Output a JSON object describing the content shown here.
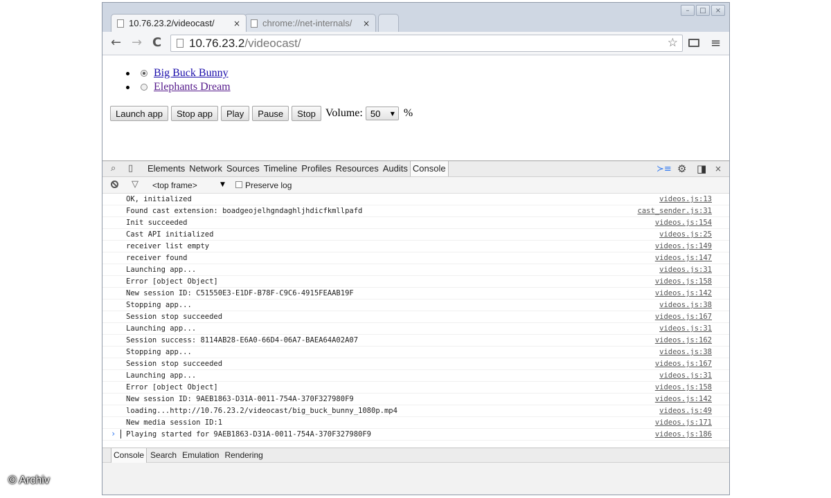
{
  "browser": {
    "tabs": [
      {
        "title": "10.76.23.2/videocast/",
        "active": true
      },
      {
        "title": "chrome://net-internals/",
        "active": false
      }
    ],
    "tab_close": "×",
    "window_buttons": {
      "minimize": "–",
      "maximize": "□",
      "close": "×"
    },
    "nav": {
      "back": "←",
      "forward": "→",
      "reload": "C"
    },
    "url": {
      "host": "10.76.23.2",
      "path": "/videocast/"
    },
    "star": "☆",
    "menu": "≡"
  },
  "page": {
    "videos": [
      {
        "title": "Big Buck Bunny",
        "selected": true
      },
      {
        "title": "Elephants Dream",
        "selected": false
      }
    ],
    "buttons": {
      "launch": "Launch app",
      "stop_app": "Stop app",
      "play": "Play",
      "pause": "Pause",
      "stop": "Stop"
    },
    "volume_label": "Volume:",
    "volume_value": "50",
    "volume_unit": "%"
  },
  "devtools": {
    "tabs": [
      "Elements",
      "Network",
      "Sources",
      "Timeline",
      "Profiles",
      "Resources",
      "Audits",
      "Console"
    ],
    "active_tab": "Console",
    "frame": "<top frame>",
    "preserve_log": "Preserve log",
    "console_rows": [
      {
        "msg": "OK, initialized",
        "src": "videos.js:13"
      },
      {
        "msg": "Found cast extension: boadgeojelhgndaghljhdicfkmllpafd",
        "src": "cast_sender.js:31"
      },
      {
        "msg": "Init succeeded",
        "src": "videos.js:154"
      },
      {
        "msg": "Cast API initialized",
        "src": "videos.js:25"
      },
      {
        "msg": "receiver list empty",
        "src": "videos.js:149"
      },
      {
        "msg": "receiver found",
        "src": "videos.js:147"
      },
      {
        "msg": "Launching app...",
        "src": "videos.js:31"
      },
      {
        "msg": "Error [object Object]",
        "src": "videos.js:158"
      },
      {
        "msg": "New session ID: C51550E3-E1DF-B78F-C9C6-4915FEAAB19F",
        "src": "videos.js:142"
      },
      {
        "msg": "Stopping app...",
        "src": "videos.js:38"
      },
      {
        "msg": "Session stop succeeded",
        "src": "videos.js:167"
      },
      {
        "msg": "Launching app...",
        "src": "videos.js:31"
      },
      {
        "msg": "Session success: 8114AB28-E6A0-66D4-06A7-BAEA64A02A07",
        "src": "videos.js:162"
      },
      {
        "msg": "Stopping app...",
        "src": "videos.js:38"
      },
      {
        "msg": "Session stop succeeded",
        "src": "videos.js:167"
      },
      {
        "msg": "Launching app...",
        "src": "videos.js:31"
      },
      {
        "msg": "Error [object Object]",
        "src": "videos.js:158"
      },
      {
        "msg": "New session ID: 9AEB1863-D31A-0011-754A-370F327980F9",
        "src": "videos.js:142"
      },
      {
        "msg": "loading...http://10.76.23.2/videocast/big_buck_bunny_1080p.mp4",
        "src": "videos.js:49"
      },
      {
        "msg": "New media session ID:1",
        "src": "videos.js:171"
      },
      {
        "msg": "Playing started for 9AEB1863-D31A-0011-754A-370F327980F9",
        "src": "videos.js:186"
      }
    ],
    "prompt": "›",
    "drawer_tabs": [
      "Console",
      "Search",
      "Emulation",
      "Rendering"
    ],
    "drawer_active": "Console"
  },
  "watermark": "© Archiv"
}
